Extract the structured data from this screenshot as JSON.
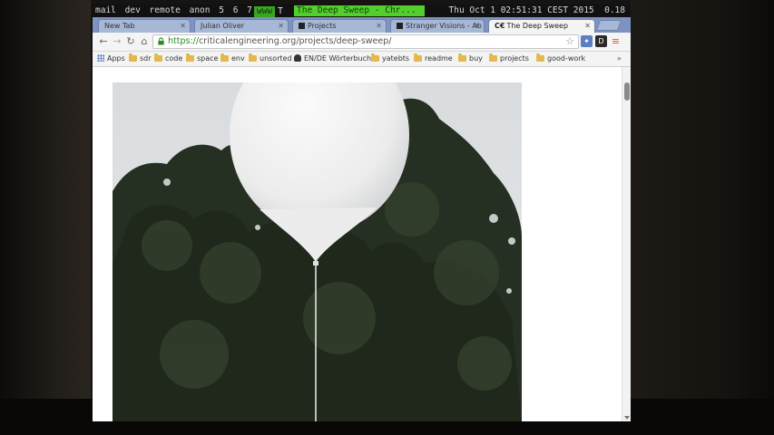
{
  "wm": {
    "items": [
      "mail",
      "dev",
      "remote",
      "anon",
      "5",
      "6",
      "7"
    ],
    "tag_active": "www",
    "tag_other": "T",
    "window_title": "The Deep Sweep - Chr...",
    "clock": "Thu Oct  1 02:51:31 CEST 2015",
    "load": "0.18"
  },
  "tabs": [
    {
      "label": "New Tab"
    },
    {
      "label": "Julian Oliver"
    },
    {
      "label": "Projects"
    },
    {
      "label": "Stranger Visions - Ab"
    },
    {
      "label": "The Deep Sweep"
    }
  ],
  "toolbar": {
    "url_scheme": "https://",
    "url_rest": "criticalengineering.org/projects/deep-sweep/",
    "extensions": [
      {
        "name": "puzzle-extension-icon",
        "color": "#5b7ec4"
      },
      {
        "name": "d-extension-icon",
        "color": "#2a2a2a",
        "text": "D"
      },
      {
        "name": "shield-extension-icon",
        "color": "#3b62a8"
      }
    ]
  },
  "bookmarks": [
    {
      "label": "Apps",
      "icon": "apps-icon"
    },
    {
      "label": "sdr",
      "icon": "folder-icon"
    },
    {
      "label": "code",
      "icon": "folder-icon"
    },
    {
      "label": "space",
      "icon": "folder-icon"
    },
    {
      "label": "env",
      "icon": "folder-icon"
    },
    {
      "label": "unsorted",
      "icon": "folder-icon"
    },
    {
      "label": "EN/DE Wörterbuch",
      "icon": "leo-icon"
    },
    {
      "label": "yatebts",
      "icon": "folder-icon"
    },
    {
      "label": "readme",
      "icon": "folder-icon"
    },
    {
      "label": "buy",
      "icon": "folder-icon"
    },
    {
      "label": "projects",
      "icon": "folder-icon"
    },
    {
      "label": "good-work",
      "icon": "folder-icon"
    }
  ],
  "colors": {
    "wm_accent": "#52cf2c",
    "tabstrip": "#7d94c2",
    "url_secure": "#2a8a2a"
  }
}
